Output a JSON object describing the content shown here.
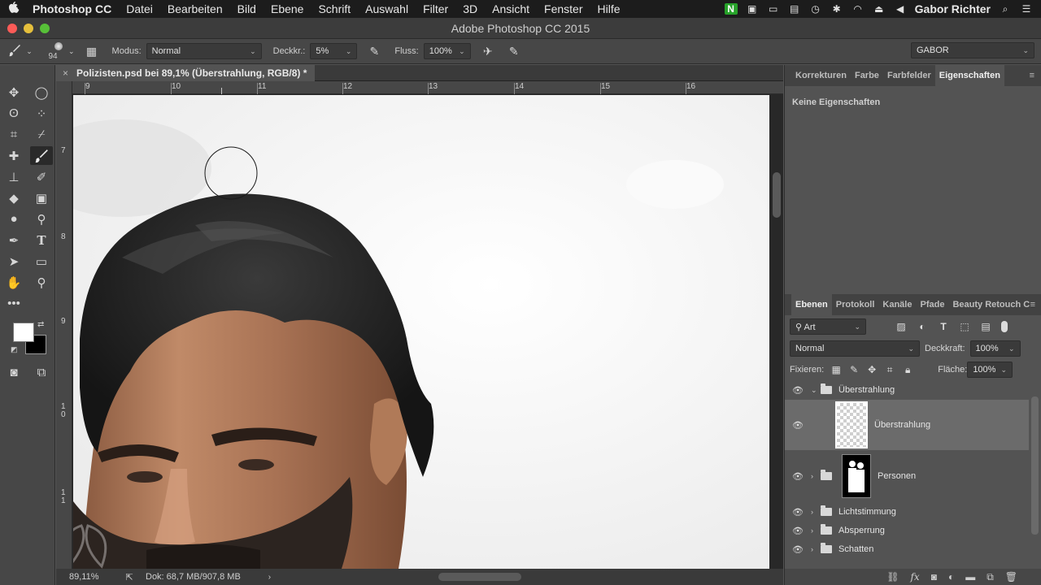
{
  "menubar": {
    "items": [
      "Photoshop CC",
      "Datei",
      "Bearbeiten",
      "Bild",
      "Ebene",
      "Schrift",
      "Auswahl",
      "Filter",
      "3D",
      "Ansicht",
      "Fenster",
      "Hilfe"
    ],
    "user": "Gabor Richter",
    "status_icons": [
      "evernote-icon",
      "folder-icon",
      "cast-icon",
      "battery-icon",
      "time-machine-icon",
      "bluetooth-icon",
      "wifi-icon",
      "eject-icon",
      "volume-icon",
      "search-icon",
      "list-icon"
    ]
  },
  "window": {
    "title": "Adobe Photoshop CC 2015"
  },
  "options": {
    "brush_size": "94",
    "mode_label": "Modus:",
    "mode_value": "Normal",
    "opacity_label": "Deckkr.:",
    "opacity_value": "5%",
    "flow_label": "Fluss:",
    "flow_value": "100%",
    "workspace": "GABOR"
  },
  "document": {
    "tab_title": "Polizisten.psd bei 89,1% (Überstrahlung, RGB/8) *",
    "ruler_top": [
      "9",
      "10",
      "11",
      "12",
      "13",
      "14",
      "15",
      "16"
    ],
    "ruler_left": [
      "7",
      "8",
      "9",
      "1 0",
      "1 1"
    ],
    "zoom": "89,11%",
    "doc_info": "Dok: 68,7 MB/907,8 MB"
  },
  "properties": {
    "tabs": [
      "Korrekturen",
      "Farbe",
      "Farbfelder",
      "Eigenschaften"
    ],
    "active_tab": "Eigenschaften",
    "body_text": "Keine Eigenschaften"
  },
  "layers": {
    "tabs": [
      "Ebenen",
      "Protokoll",
      "Kanäle",
      "Pfade",
      "Beauty Retouch C"
    ],
    "filter_value": "Art",
    "blend_mode": "Normal",
    "opacity_label": "Deckkraft:",
    "opacity_value": "100%",
    "lock_label": "Fixieren:",
    "fill_label": "Fläche:",
    "fill_value": "100%",
    "items": [
      {
        "name": "Überstrahlung",
        "type": "group",
        "expanded": true
      },
      {
        "name": "Überstrahlung",
        "type": "layer",
        "selected": true
      },
      {
        "name": "Personen",
        "type": "group-mask"
      },
      {
        "name": "Lichtstimmung",
        "type": "group"
      },
      {
        "name": "Absperrung",
        "type": "group"
      },
      {
        "name": "Schatten",
        "type": "group"
      }
    ]
  },
  "colors": {
    "foreground": "#ffffff",
    "background": "#000000",
    "accent_green": "#27a22a"
  }
}
